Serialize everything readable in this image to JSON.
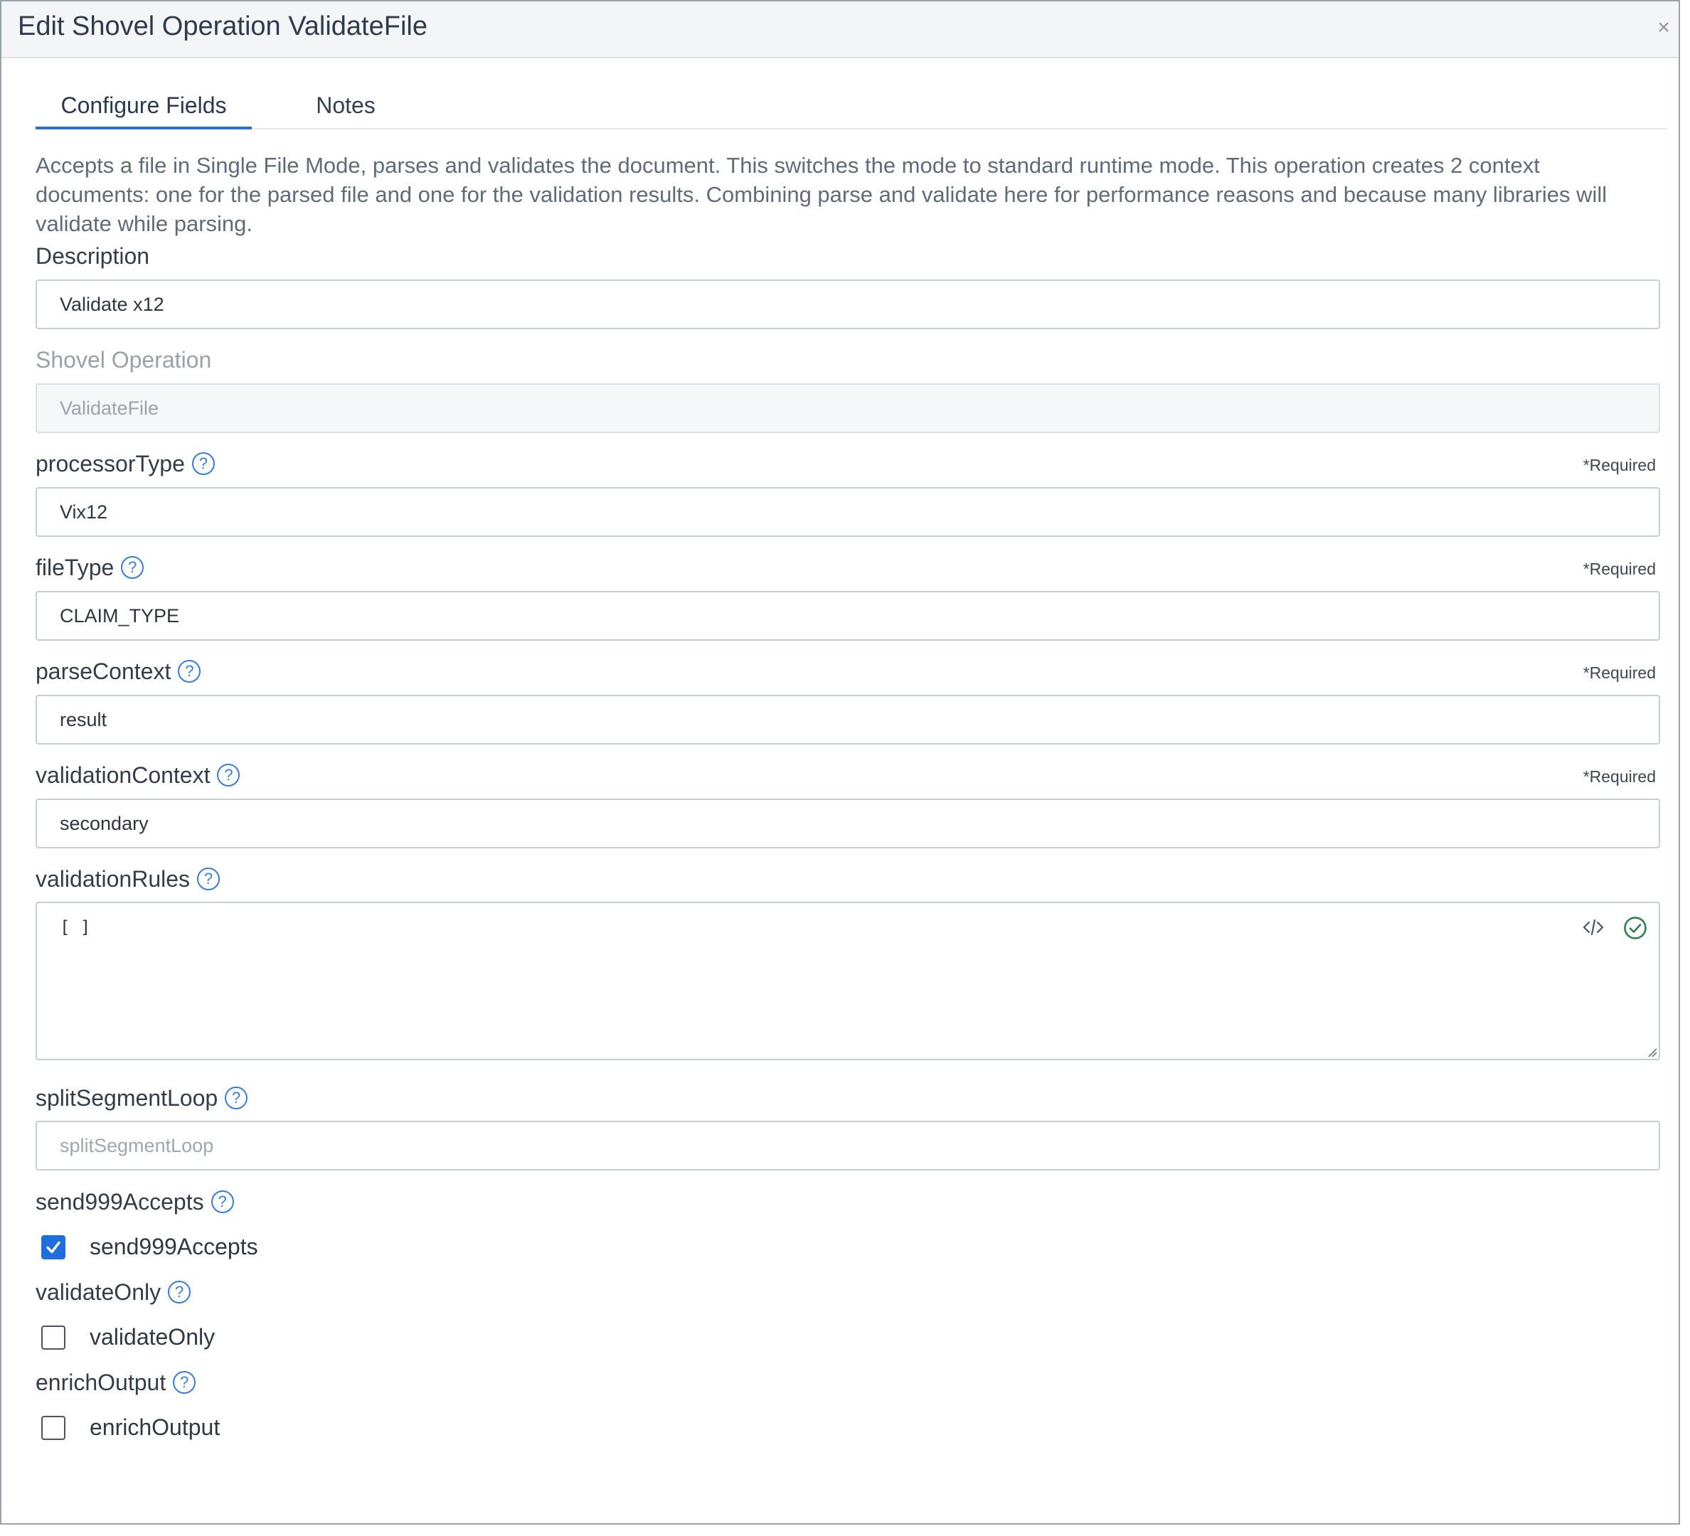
{
  "modal": {
    "title": "Edit Shovel Operation ValidateFile",
    "close_glyph": "×"
  },
  "tabs": [
    {
      "label": "Configure Fields",
      "active": true
    },
    {
      "label": "Notes",
      "active": false
    }
  ],
  "intro_text": "Accepts a file in Single File Mode, parses and validates the document. This switches the mode to standard runtime mode. This operation creates 2 context documents: one for the parsed file and one for the validation results. Combining parse and validate here for performance reasons and because many libraries will validate while parsing.",
  "fields": {
    "description": {
      "label": "Description",
      "value": "Validate x12"
    },
    "shovel_operation": {
      "label": "Shovel Operation",
      "value": "ValidateFile"
    },
    "processor_type": {
      "label": "processorType",
      "value": "Vix12",
      "required": "*Required"
    },
    "file_type": {
      "label": "fileType",
      "value": "CLAIM_TYPE",
      "required": "*Required"
    },
    "parse_context": {
      "label": "parseContext",
      "value": "result",
      "required": "*Required"
    },
    "validation_context": {
      "label": "validationContext",
      "value": "secondary",
      "required": "*Required"
    },
    "validation_rules": {
      "label": "validationRules",
      "value": "[ ]"
    },
    "split_segment_loop": {
      "label": "splitSegmentLoop",
      "placeholder": "splitSegmentLoop"
    },
    "send999_accepts": {
      "label": "send999Accepts",
      "checkbox_label": "send999Accepts",
      "checked": true
    },
    "validate_only": {
      "label": "validateOnly",
      "checkbox_label": "validateOnly",
      "checked": false
    },
    "enrich_output": {
      "label": "enrichOutput",
      "checkbox_label": "enrichOutput",
      "checked": false
    }
  },
  "help_glyph": "?",
  "colors": {
    "accent": "#2d72c4",
    "checkbox_checked": "#1e6fdb",
    "valid_check": "#2e7d4f"
  },
  "icons": {
    "code": "code-icon",
    "valid": "check-circle-icon",
    "help": "help-circle-icon",
    "close": "close-icon"
  }
}
